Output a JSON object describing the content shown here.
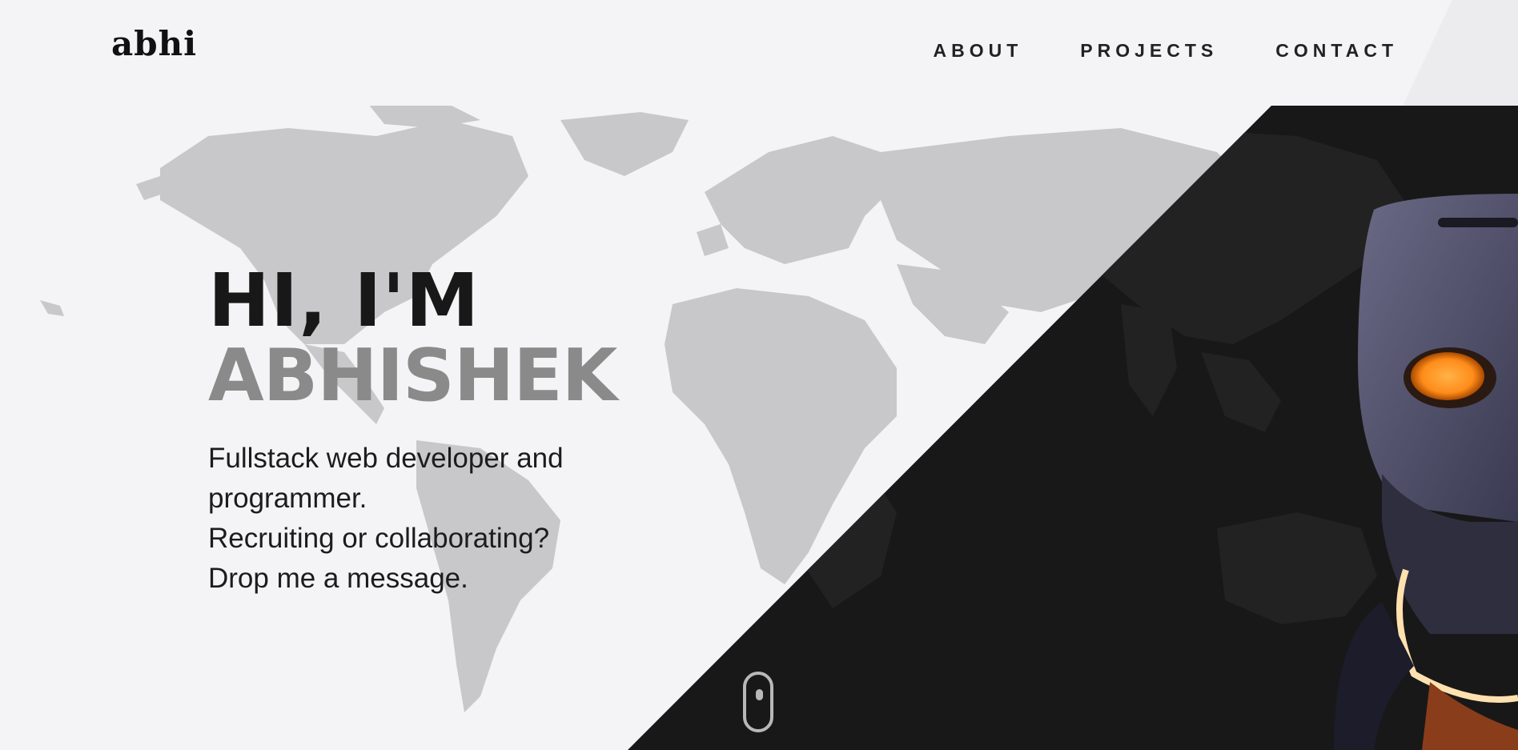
{
  "header": {
    "logo": "abhi",
    "nav": [
      {
        "label": "ABOUT"
      },
      {
        "label": "PROJECTS"
      },
      {
        "label": "CONTACT"
      }
    ]
  },
  "hero": {
    "greeting": "HI, I'M",
    "name": "ABHISHEK",
    "description": [
      "Fullstack web developer and",
      "programmer.",
      "Recruiting or collaborating?",
      "Drop me a message."
    ]
  },
  "colors": {
    "background": "#f4f4f6",
    "dark_panel": "#181818",
    "text_primary": "#181818",
    "text_secondary": "#8a8a8a",
    "map_light": "#c9c9cb",
    "accent_glow": "#ff9a2a"
  },
  "icons": {
    "scroll": "mouse-scroll-icon",
    "background": "world-map",
    "hero_image": "robot-head"
  }
}
